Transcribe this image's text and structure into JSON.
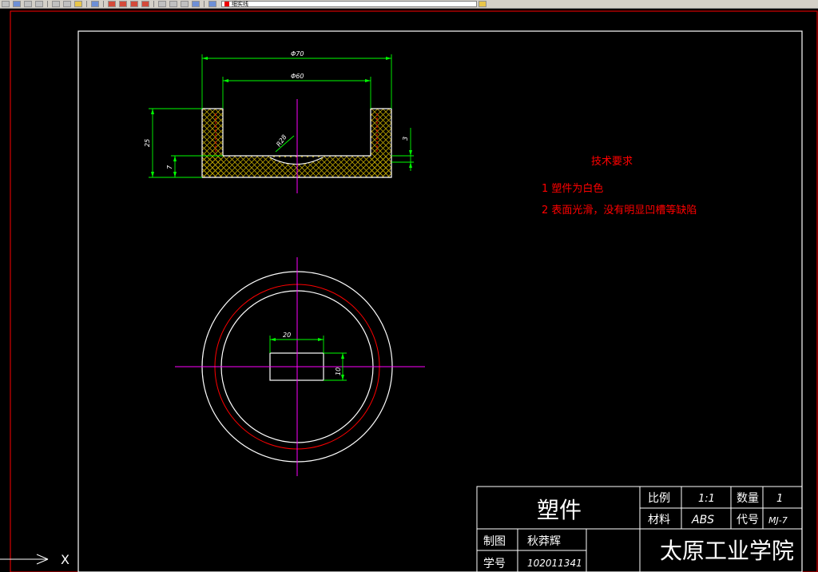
{
  "toolbar": {
    "layer_name": "细实线",
    "icons": [
      "new-icon",
      "open-icon",
      "save-icon",
      "print-icon",
      "cut-icon",
      "copy-icon",
      "paste-icon",
      "undo-icon",
      "pan-icon",
      "zoom-icon",
      "zoom-window-icon",
      "zoom-previous-icon",
      "properties-icon",
      "design-center-icon",
      "tool-palettes-icon",
      "help-icon",
      "layer-manager-icon",
      "layer-state-icon"
    ]
  },
  "drawing": {
    "colors": {
      "white": "#ffffff",
      "red": "#ff0000",
      "green": "#00ff00",
      "magenta": "#ff00ff",
      "hatch": "#b8a000"
    },
    "dims": {
      "outer_dia": "Φ70",
      "inner_dia": "Φ60",
      "height": "25",
      "bottom": "7",
      "right_step": "3",
      "radius": "R28",
      "slot_width": "20",
      "slot_height": "10"
    },
    "tech_req": {
      "title": "技术要求",
      "items": [
        "1  塑件为白色",
        "2  表面光滑，没有明显凹槽等缺陷"
      ]
    },
    "title_block": {
      "part_name": "塑件",
      "scale_label": "比例",
      "scale_value": "1:1",
      "qty_label": "数量",
      "qty_value": "1",
      "material_label": "材料",
      "material_value": "ABS",
      "code_label": "代号",
      "code_value": "MJ-7",
      "drawn_label": "制图",
      "drawn_value": "秋莽辉",
      "student_label": "学号",
      "student_value": "102011341",
      "school": "太原工业学院"
    },
    "ucs": {
      "x_label": "X"
    }
  }
}
